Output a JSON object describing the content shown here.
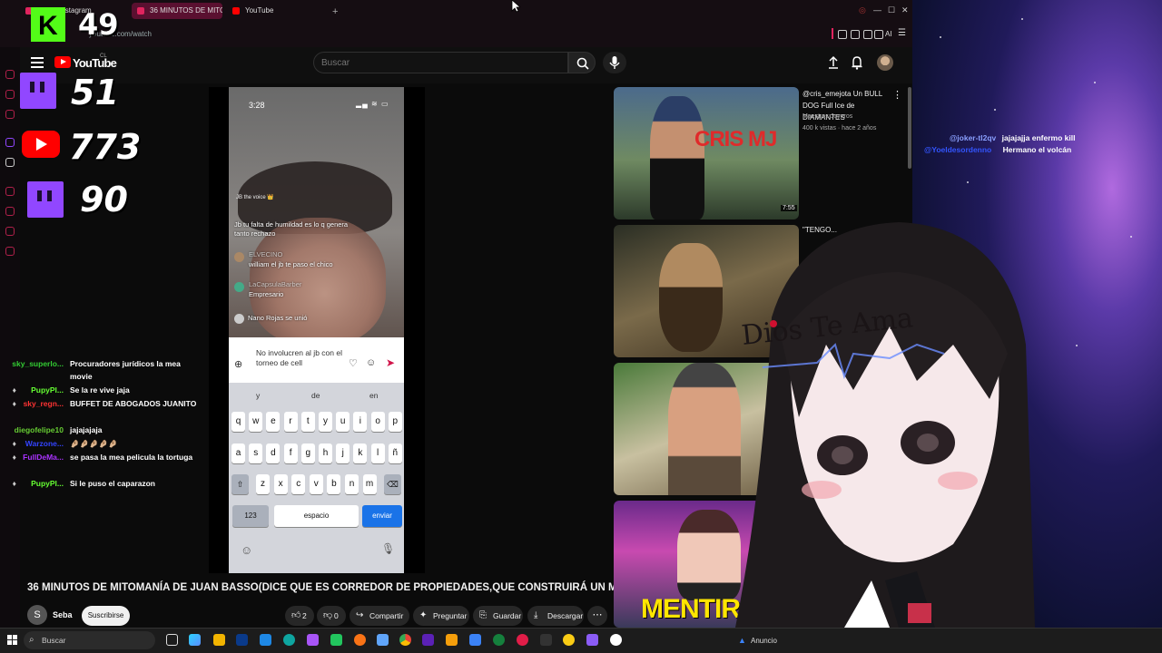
{
  "browser": {
    "tabs": [
      {
        "label": "Gmail Instagram"
      },
      {
        "label": "36 MINUTOS DE MITO"
      },
      {
        "label": "YouTube"
      }
    ],
    "new_tab": "+",
    "url": "youtube.com/watch",
    "toolbar_ai": "AI"
  },
  "youtube": {
    "logo_text": "YouTube",
    "region": "CL",
    "search_placeholder": "Buscar",
    "video": {
      "title": "36 MINUTOS DE MITOMANÍA DE JUAN BASSO(DICE QUE ES CORREDOR DE PROPIEDADES,QUE CONSTRUIRÁ UN MOTEL)",
      "channel_initial": "S",
      "channel_name": "Seba",
      "subscribe_label": "Suscribirse",
      "likes": "2",
      "dislikes": "0",
      "share_label": "Compartir",
      "ask_label": "Preguntar",
      "save_label": "Guardar",
      "download_label": "Descargar",
      "more_label": "⋯"
    },
    "phone": {
      "time": "3:28",
      "status": "▂▄ ≋ ▭",
      "live_title": "JB the voice 👑",
      "chat": [
        {
          "name": "",
          "text": "Jb tu falta de humildad es lo q genera tanto rechazo"
        },
        {
          "name": "ELVECINO",
          "text": "william el jb te paso el chico"
        },
        {
          "name": "LaCapsulaBarber",
          "text": "Empresario"
        },
        {
          "name": "",
          "text": "Nano Rojas se unió"
        }
      ],
      "reply_text": "No involucren al jb con el torneo de cell",
      "suggestions": [
        "y",
        "de",
        "en"
      ],
      "keys_row1": [
        "q",
        "w",
        "e",
        "r",
        "t",
        "y",
        "u",
        "i",
        "o",
        "p"
      ],
      "keys_row2": [
        "a",
        "s",
        "d",
        "f",
        "g",
        "h",
        "j",
        "k",
        "l",
        "ñ"
      ],
      "keys_row3": [
        "z",
        "x",
        "c",
        "v",
        "b",
        "n",
        "m"
      ],
      "key_123": "123",
      "key_space": "espacio",
      "key_send": "enviar"
    },
    "recommendations": [
      {
        "title": "@cris_emejota  Un BULL DOG Full Ice de DIAMANTES",
        "channel": "Maestros Joyeros",
        "meta": "400 k vistas · hace 2 años",
        "overlay": "CRIS MJ",
        "duration": "7:55"
      },
      {
        "title": "\"TENGO...",
        "overlay": ""
      },
      {
        "title": "",
        "overlay": ""
      },
      {
        "title": "",
        "overlay": "MENTIROSA"
      }
    ]
  },
  "stream_overlay": {
    "counters": [
      {
        "platform": "kick-icon",
        "value": "49"
      },
      {
        "platform": "twitch-icon",
        "value": "51"
      },
      {
        "platform": "youtube-icon",
        "value": "773"
      },
      {
        "platform": "twitch-icon",
        "value": "90"
      }
    ],
    "chat": [
      {
        "name": "sky_superlo...",
        "name_color": "#33cc33",
        "text": "Procuradores jurídicos la mea movie"
      },
      {
        "name": "PupyPl...",
        "name_color": "#66ff33",
        "text": "Se la re vive jaja"
      },
      {
        "name": "sky_regn...",
        "name_color": "#ff3333",
        "text": "BUFFET DE ABOGADOS JUANITO"
      },
      {
        "name": "diegofelipe10",
        "name_color": "#66cc33",
        "text": "jajajajaja"
      },
      {
        "name": "Warzone...",
        "name_color": "#3344ff",
        "text": "🤌🏼🤌🏼🤌🏼🤌🏼🤌🏼"
      },
      {
        "name": "FullDeMa...",
        "name_color": "#aa33ff",
        "text": "se pasa la mea pelicula la tortuga"
      },
      {
        "name": "PupyPl...",
        "name_color": "#66ff33",
        "text": "Si le puso el caparazon"
      }
    ],
    "right_chat": [
      {
        "name": "@joker-tl2qv",
        "name_color": "#8aa0ff",
        "text": "jajajajja enfermo kill"
      },
      {
        "name": "@Yoeldesordenno",
        "name_color": "#3355ff",
        "text": "Hermano el volcán"
      }
    ],
    "vtuber_text": "Dios Te Ama"
  },
  "taskbar": {
    "search_label": "Buscar",
    "news_label": "Anuncio"
  },
  "colors": {
    "youtube_red": "#ff0000",
    "twitch_purple": "#9147ff",
    "kick_green": "#53fc18",
    "yt_bg": "#0f0f0f"
  }
}
